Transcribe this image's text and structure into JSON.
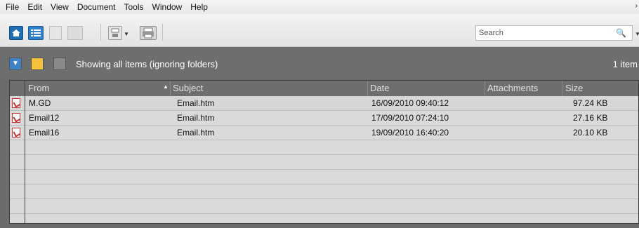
{
  "menu": [
    "File",
    "Edit",
    "View",
    "Document",
    "Tools",
    "Window",
    "Help"
  ],
  "menu_more": "›",
  "search": {
    "placeholder": "Search"
  },
  "filter_bar": {
    "status": "Showing all items (ignoring folders)",
    "count": "1 item"
  },
  "table": {
    "columns": [
      "From",
      "Subject",
      "Date",
      "Attachments",
      "Size"
    ],
    "sort_indicator": "▲",
    "rows": [
      {
        "from": "M.GD",
        "subject": "Email.htm",
        "date": "16/09/2010 09:40:12",
        "attachments": "",
        "size": "97.24 KB"
      },
      {
        "from": "Email12",
        "subject": "Email.htm",
        "date": "17/09/2010 07:24:10",
        "attachments": "",
        "size": "27.16 KB"
      },
      {
        "from": "Email16",
        "subject": "Email.htm",
        "date": "19/09/2010 16:40:20",
        "attachments": "",
        "size": "20.10 KB"
      }
    ]
  }
}
